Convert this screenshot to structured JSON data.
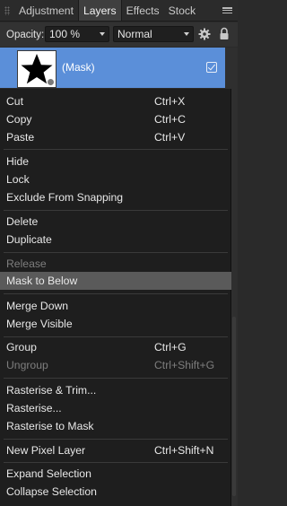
{
  "tabs": [
    {
      "label": "Adjustment",
      "active": false
    },
    {
      "label": "Layers",
      "active": true
    },
    {
      "label": "Effects",
      "active": false
    },
    {
      "label": "Stock",
      "active": false
    }
  ],
  "toolbar": {
    "opacity_label": "Opacity:",
    "opacity_value": "100 %",
    "blend_mode": "Normal"
  },
  "layer": {
    "name": "(Mask)",
    "visible": true
  },
  "menu": {
    "cut": {
      "label": "Cut",
      "shortcut": "Ctrl+X"
    },
    "copy": {
      "label": "Copy",
      "shortcut": "Ctrl+C"
    },
    "paste": {
      "label": "Paste",
      "shortcut": "Ctrl+V"
    },
    "hide": {
      "label": "Hide"
    },
    "lock": {
      "label": "Lock"
    },
    "exclude_snapping": {
      "label": "Exclude From Snapping"
    },
    "delete": {
      "label": "Delete"
    },
    "duplicate": {
      "label": "Duplicate"
    },
    "release": {
      "label": "Release",
      "disabled": true
    },
    "mask_to_below": {
      "label": "Mask to Below",
      "highlighted": true
    },
    "merge_down": {
      "label": "Merge Down"
    },
    "merge_visible": {
      "label": "Merge Visible"
    },
    "group": {
      "label": "Group",
      "shortcut": "Ctrl+G"
    },
    "ungroup": {
      "label": "Ungroup",
      "shortcut": "Ctrl+Shift+G",
      "disabled": true
    },
    "rasterise_trim": {
      "label": "Rasterise & Trim..."
    },
    "rasterise": {
      "label": "Rasterise..."
    },
    "rasterise_mask": {
      "label": "Rasterise to Mask"
    },
    "new_pixel_layer": {
      "label": "New Pixel Layer",
      "shortcut": "Ctrl+Shift+N"
    },
    "expand_selection": {
      "label": "Expand Selection"
    },
    "collapse_selection": {
      "label": "Collapse Selection"
    }
  },
  "colors": {
    "selected_layer": "#5b8fd9",
    "menu_bg": "#1e1e1e",
    "menu_hover": "#5a5a5a",
    "disabled_text": "#7e7e7e"
  }
}
